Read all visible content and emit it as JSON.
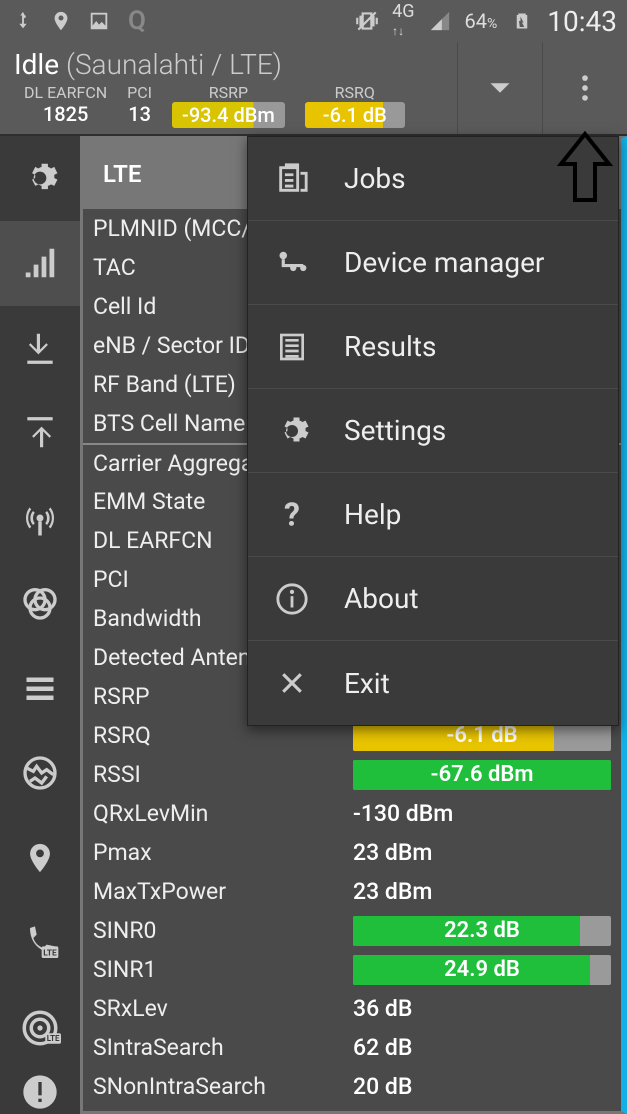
{
  "statusbar": {
    "battery": "64",
    "battery_pct": "%",
    "time": "10:43",
    "net": "4G"
  },
  "header": {
    "state": "Idle",
    "carrier": "(Saunalahti / LTE)",
    "metrics": {
      "earfcn_lbl": "DL EARFCN",
      "earfcn_val": "1825",
      "pci_lbl": "PCI",
      "pci_val": "13",
      "rsrp_lbl": "RSRP",
      "rsrp_val": "-93.4 dBm",
      "rsrq_lbl": "RSRQ",
      "rsrq_val": "-6.1 dB"
    }
  },
  "tab": {
    "title": "LTE"
  },
  "rows": [
    {
      "k": "PLMNID (MCC/MNC)",
      "v": ""
    },
    {
      "k": "TAC",
      "v": ""
    },
    {
      "k": "Cell Id",
      "v": ""
    },
    {
      "k": "eNB / Sector ID",
      "v": ""
    },
    {
      "k": "RF Band (LTE)",
      "v": ""
    },
    {
      "k": "BTS Cell Name",
      "v": ""
    },
    {
      "k": "Carrier Aggregation",
      "v": "",
      "sep": true
    },
    {
      "k": "EMM State",
      "v": ""
    },
    {
      "k": "DL EARFCN",
      "v": ""
    },
    {
      "k": "PCI",
      "v": ""
    },
    {
      "k": "Bandwidth",
      "v": ""
    },
    {
      "k": "Detected Antennas",
      "v": ""
    },
    {
      "k": "RSRP",
      "v": ""
    },
    {
      "k": "RSRQ",
      "bar": {
        "text": "-6.1 dB",
        "color": "#e8c400",
        "pct": 78
      }
    },
    {
      "k": "RSSI",
      "bar": {
        "text": "-67.6 dBm",
        "color": "#1fbf3c",
        "pct": 100
      }
    },
    {
      "k": "QRxLevMin",
      "v": "-130 dBm"
    },
    {
      "k": "Pmax",
      "v": "23 dBm"
    },
    {
      "k": "MaxTxPower",
      "v": "23 dBm"
    },
    {
      "k": "SINR0",
      "bar": {
        "text": "22.3 dB",
        "color": "#1fbf3c",
        "pct": 88
      }
    },
    {
      "k": "SINR1",
      "bar": {
        "text": "24.9 dB",
        "color": "#1fbf3c",
        "pct": 92
      }
    },
    {
      "k": "SRxLev",
      "v": "36 dB"
    },
    {
      "k": "SIntraSearch",
      "v": "62 dB"
    },
    {
      "k": "SNonIntraSearch",
      "v": "20 dB"
    }
  ],
  "menu": [
    {
      "icon": "jobs",
      "label": "Jobs"
    },
    {
      "icon": "device",
      "label": "Device manager"
    },
    {
      "icon": "results",
      "label": "Results"
    },
    {
      "icon": "settings",
      "label": "Settings"
    },
    {
      "icon": "help",
      "label": "Help"
    },
    {
      "icon": "about",
      "label": "About"
    },
    {
      "icon": "exit",
      "label": "Exit"
    }
  ]
}
